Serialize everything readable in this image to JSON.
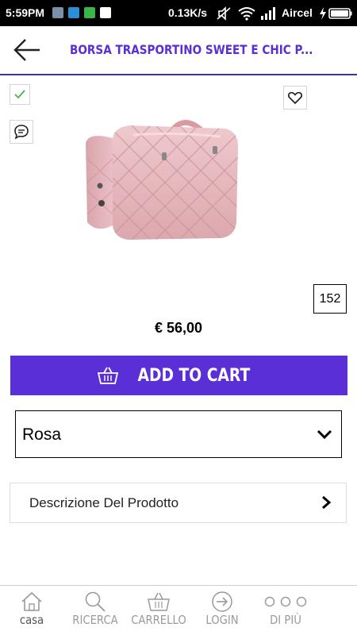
{
  "status_bar": {
    "time": "5:59PM",
    "network_speed": "0.13K/s",
    "carrier": "Aircel"
  },
  "header": {
    "title": "BORSA TRASPORTINO SWEET E CHIC P...",
    "back_icon": "arrow-left-icon"
  },
  "actions": {
    "check_icon": "check-icon",
    "chat_icon": "chat-bubble-icon",
    "wishlist_icon": "heart-icon"
  },
  "product": {
    "image_alt": "pink-quilted-pet-carrier-bag",
    "count": "152",
    "price": "€ 56,00"
  },
  "cart": {
    "label": "ADD TO CART",
    "icon": "basket-icon"
  },
  "color_select": {
    "value": "Rosa"
  },
  "description": {
    "label": "Descrizione Del Prodotto"
  },
  "bottom_nav": {
    "items": [
      {
        "label": "casa",
        "icon": "home-icon"
      },
      {
        "label": "RICERCA",
        "icon": "search-icon"
      },
      {
        "label": "CARRELLO",
        "icon": "basket-icon"
      },
      {
        "label": "LOGIN",
        "icon": "login-arrow-icon"
      },
      {
        "label": "DI PIÙ",
        "icon": "more-dots-icon"
      }
    ]
  },
  "colors": {
    "accent": "#5b2fd6",
    "header_line": "#3a2fb5",
    "check_green": "#4caf50"
  }
}
